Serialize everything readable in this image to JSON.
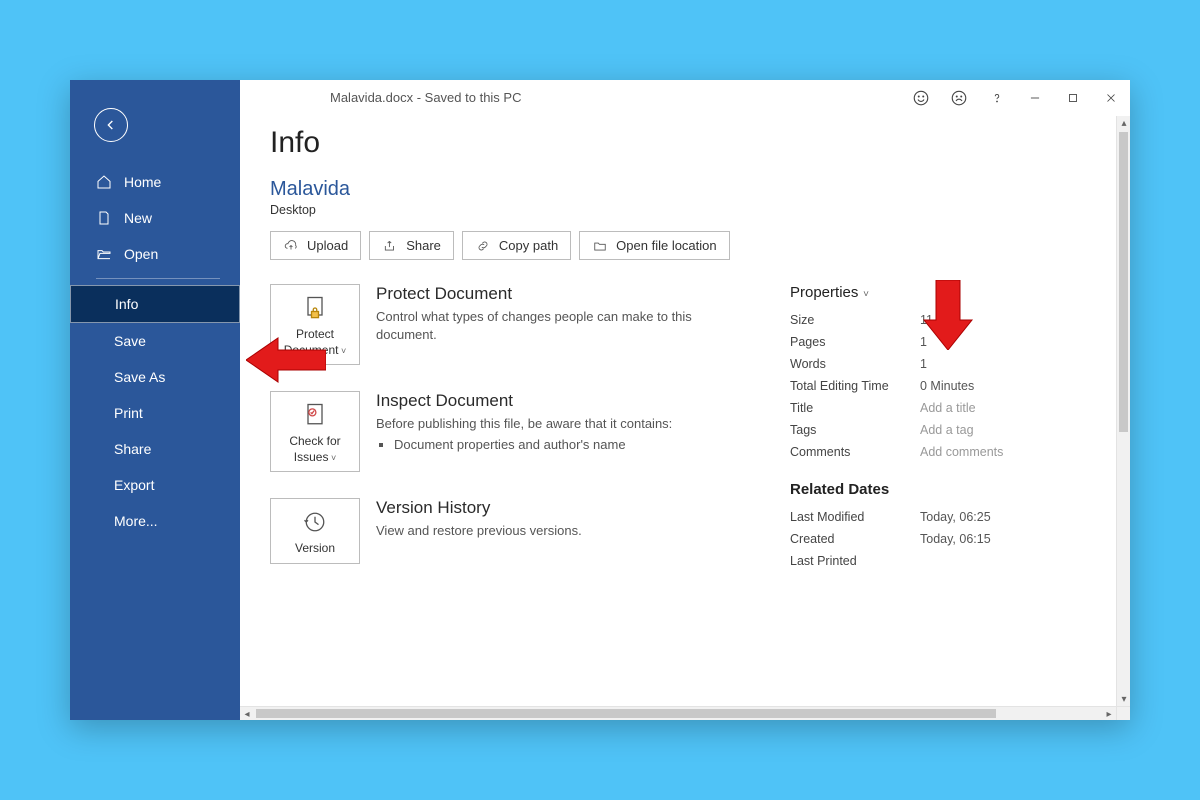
{
  "titlebar": {
    "document": "Malavida.docx  -  Saved to this PC"
  },
  "sidebar": {
    "home": "Home",
    "new": "New",
    "open": "Open",
    "info": "Info",
    "save": "Save",
    "save_as": "Save As",
    "print": "Print",
    "share": "Share",
    "export": "Export",
    "more": "More..."
  },
  "page": {
    "title": "Info",
    "doc_name": "Malavida",
    "doc_location": "Desktop"
  },
  "actions": {
    "upload": "Upload",
    "share": "Share",
    "copy_path": "Copy path",
    "open_loc": "Open file location"
  },
  "blocks": {
    "protect": {
      "btn_l1": "Protect",
      "btn_l2": "Document",
      "title": "Protect Document",
      "desc": "Control what types of changes people can make to this document."
    },
    "inspect": {
      "btn_l1": "Check for",
      "btn_l2": "Issues",
      "title": "Inspect Document",
      "desc": "Before publishing this file, be aware that it contains:",
      "item1": "Document properties and author's name"
    },
    "version": {
      "btn_l1": "Version",
      "title": "Version History",
      "desc": "View and restore previous versions."
    }
  },
  "properties": {
    "heading": "Properties",
    "rows": {
      "size": {
        "k": "Size",
        "v": "11.6KB"
      },
      "pages": {
        "k": "Pages",
        "v": "1"
      },
      "words": {
        "k": "Words",
        "v": "1"
      },
      "edit_time": {
        "k": "Total Editing Time",
        "v": "0 Minutes"
      },
      "title": {
        "k": "Title",
        "v": "Add a title"
      },
      "tags": {
        "k": "Tags",
        "v": "Add a tag"
      },
      "comments": {
        "k": "Comments",
        "v": "Add comments"
      }
    },
    "dates_heading": "Related Dates",
    "dates": {
      "modified": {
        "k": "Last Modified",
        "v": "Today, 06:25"
      },
      "created": {
        "k": "Created",
        "v": "Today, 06:15"
      },
      "printed": {
        "k": "Last Printed",
        "v": ""
      }
    }
  },
  "annotations": {
    "arrow_color": "#e21b1b"
  }
}
